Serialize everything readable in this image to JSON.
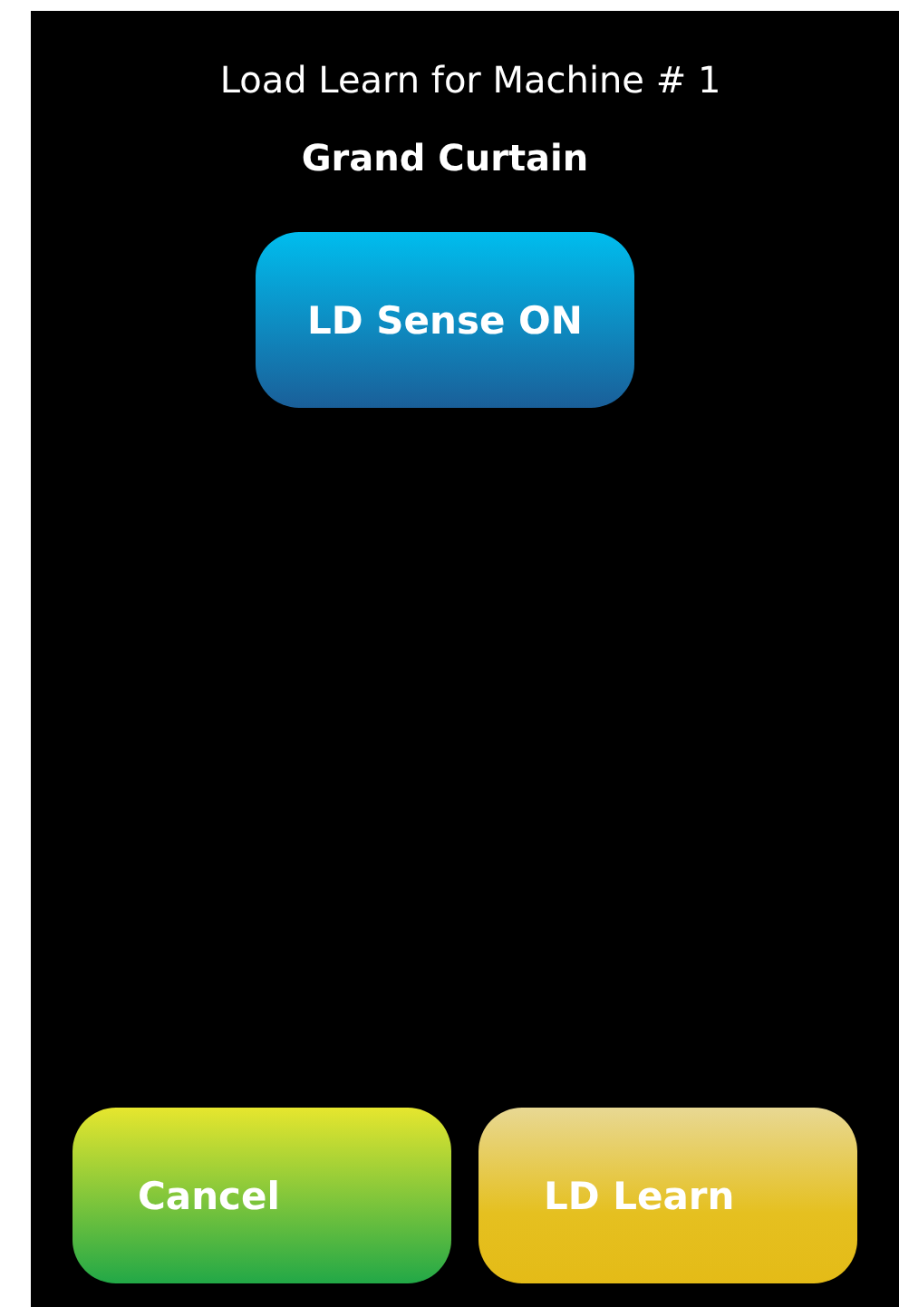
{
  "title": "Load Learn for Machine # 1",
  "subtitle": "Grand Curtain",
  "toggle_button": {
    "label": "LD Sense ON",
    "kind": "blue"
  },
  "buttons": [
    {
      "label": "Cancel",
      "kind": "green"
    },
    {
      "label": "LD Learn",
      "kind": "gold"
    }
  ]
}
